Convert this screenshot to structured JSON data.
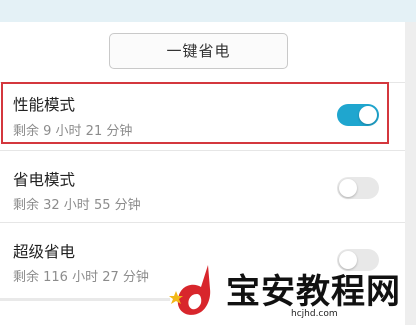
{
  "toolbar": {
    "one_key_save_label": "一键省电"
  },
  "modes": [
    {
      "title": "性能模式",
      "remaining": "剩余 9 小时 21 分钟",
      "enabled": true
    },
    {
      "title": "省电模式",
      "remaining": "剩余 32 小时 55 分钟",
      "enabled": false
    },
    {
      "title": "超级省电",
      "remaining": "剩余 116 小时 27 分钟",
      "enabled": false
    }
  ],
  "colors": {
    "toggle_on": "#1fa6cf",
    "toggle_off": "#e8e8e8",
    "highlight_border": "#d4373d"
  },
  "watermark": {
    "logo_icon": "d-letter-star-logo",
    "text": "宝安教程网",
    "url": "hcjhd.com"
  }
}
